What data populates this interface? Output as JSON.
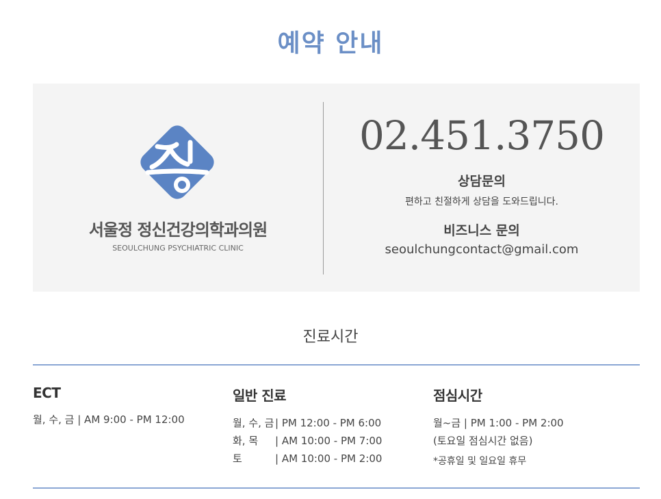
{
  "page": {
    "title": "예약 안내"
  },
  "clinic": {
    "name": "서울정 정신건강의학과의원",
    "name_en": "SEOULCHUNG PSYCHIATRIC CLINIC",
    "logo_icon": "clinic-logo-icon",
    "brand_color": "#5b84c4"
  },
  "contact": {
    "phone": "02.451.3750",
    "consult_title": "상담문의",
    "consult_desc": "편하고 친절하게 상담을 도와드립니다.",
    "business_title": "비즈니스 문의",
    "business_email": "seoulchungcontact@gmail.com"
  },
  "hours": {
    "title": "진료시간",
    "ect": {
      "title": "ECT",
      "lines": [
        "월, 수, 금 | AM 9:00 - PM 12:00"
      ]
    },
    "general": {
      "title": "일반 진료",
      "rows": [
        {
          "day": "월, 수, 금",
          "time": "| PM 12:00 - PM 6:00"
        },
        {
          "day": "화, 목",
          "time": "| AM 10:00 - PM 7:00"
        },
        {
          "day": "토",
          "time": "| AM 10:00 - PM 2:00"
        }
      ]
    },
    "lunch": {
      "title": "점심시간",
      "line1": "월~금 | PM 1:00 - PM 2:00",
      "line2": "(토요일 점심시간 없음)",
      "note": "*공휴일 및 일요일 휴무"
    }
  }
}
